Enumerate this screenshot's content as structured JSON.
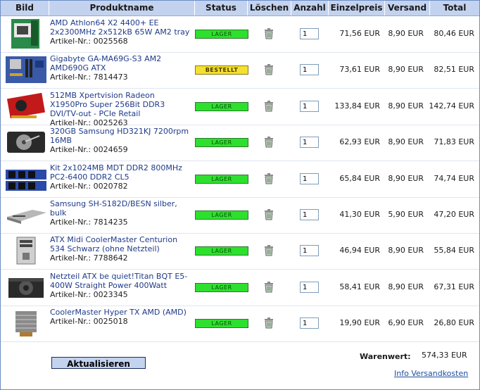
{
  "header": {
    "bild": "Bild",
    "produktname": "Produktname",
    "status": "Status",
    "loeschen": "Löschen",
    "anzahl": "Anzahl",
    "einzelpreis": "Einzelpreis",
    "versand": "Versand",
    "total": "Total"
  },
  "items": [
    {
      "name": "AMD Athlon64 X2 4400+ EE 2x2300MHz 2x512kB 65W AM2 tray",
      "artikel": "Artikel-Nr.: 0025568",
      "status": "LAGER",
      "qty": "1",
      "einzelpreis": "71,56 EUR",
      "versand": "8,90 EUR",
      "total": "80,46 EUR",
      "thumb_icon": "cpu-box-icon"
    },
    {
      "name": "Gigabyte GA-MA69G-S3 AM2 AMD690G ATX",
      "artikel": "Artikel-Nr.: 7814473",
      "status": "BESTELLT",
      "qty": "1",
      "einzelpreis": "73,61 EUR",
      "versand": "8,90 EUR",
      "total": "82,51 EUR",
      "thumb_icon": "motherboard-icon"
    },
    {
      "name": "512MB Xpertvision Radeon X1950Pro Super 256Bit DDR3 DVI/TV-out - PCIe Retail",
      "artikel": "Artikel-Nr.: 0025263",
      "status": "LAGER",
      "qty": "1",
      "einzelpreis": "133,84 EUR",
      "versand": "8,90 EUR",
      "total": "142,74 EUR",
      "thumb_icon": "graphics-card-icon"
    },
    {
      "name": "320GB Samsung HD321KJ 7200rpm 16MB",
      "artikel": "Artikel-Nr.: 0024659",
      "status": "LAGER",
      "qty": "1",
      "einzelpreis": "62,93 EUR",
      "versand": "8,90 EUR",
      "total": "71,83 EUR",
      "thumb_icon": "hard-drive-icon"
    },
    {
      "name": "Kit 2x1024MB MDT DDR2 800MHz PC2-6400 DDR2 CL5",
      "artikel": "Artikel-Nr.: 0020782",
      "status": "LAGER",
      "qty": "1",
      "einzelpreis": "65,84 EUR",
      "versand": "8,90 EUR",
      "total": "74,74 EUR",
      "thumb_icon": "ram-kit-icon"
    },
    {
      "name": "Samsung SH-S182D/BESN silber, bulk",
      "artikel": "Artikel-Nr.: 7814235",
      "status": "LAGER",
      "qty": "1",
      "einzelpreis": "41,30 EUR",
      "versand": "5,90 EUR",
      "total": "47,20 EUR",
      "thumb_icon": "optical-drive-icon"
    },
    {
      "name": "ATX Midi CoolerMaster Centurion 534 Schwarz (ohne Netzteil)",
      "artikel": "Artikel-Nr.: 7788642",
      "status": "LAGER",
      "qty": "1",
      "einzelpreis": "46,94 EUR",
      "versand": "8,90 EUR",
      "total": "55,84 EUR",
      "thumb_icon": "pc-case-icon"
    },
    {
      "name": "Netzteil ATX be quiet!Titan BQT E5-400W Straight Power 400Watt",
      "artikel": "Artikel-Nr.: 0023345",
      "status": "LAGER",
      "qty": "1",
      "einzelpreis": "58,41 EUR",
      "versand": "8,90 EUR",
      "total": "67,31 EUR",
      "thumb_icon": "power-supply-icon"
    },
    {
      "name": "CoolerMaster Hyper TX AMD (AMD)",
      "artikel": "Artikel-Nr.: 0025018",
      "status": "LAGER",
      "qty": "1",
      "einzelpreis": "19,90 EUR",
      "versand": "6,90 EUR",
      "total": "26,80 EUR",
      "thumb_icon": "cpu-cooler-icon"
    }
  ],
  "footer": {
    "warenwert_label": "Warenwert:",
    "warenwert_value": "574,33 EUR",
    "update_label": "Aktualisieren",
    "info_link": "Info Versandkosten"
  },
  "colors": {
    "header_bg": "#c3d3ef",
    "lager": "#2ee02e",
    "bestellt": "#f4e02e",
    "link": "#1e3b8a"
  }
}
